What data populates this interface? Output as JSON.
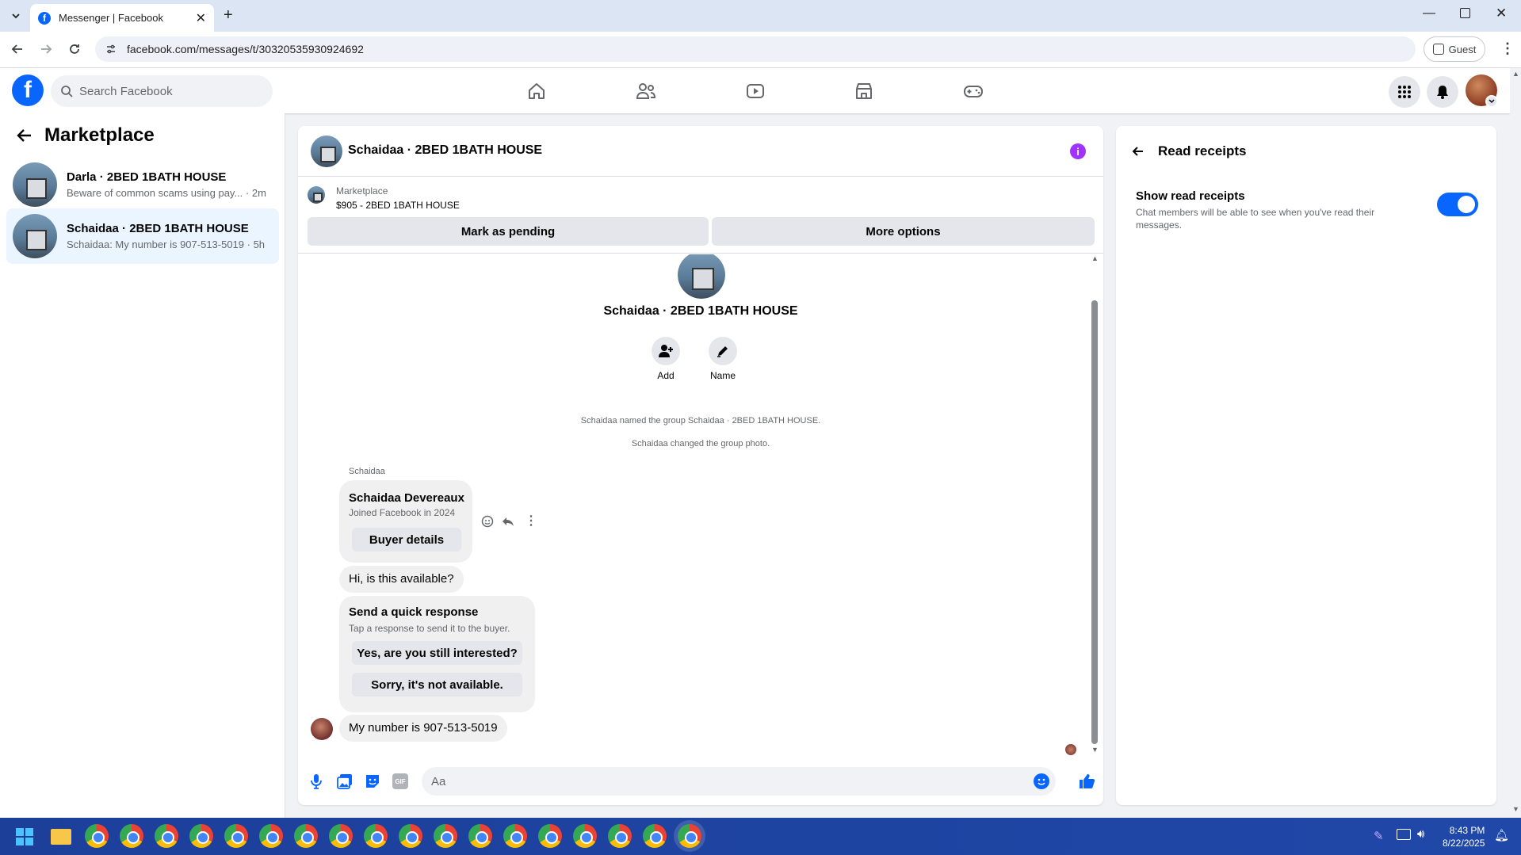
{
  "browser": {
    "tab_title": "Messenger | Facebook",
    "url": "facebook.com/messages/t/30320535930924692",
    "guest_label": "Guest"
  },
  "fb": {
    "search_placeholder": "Search Facebook"
  },
  "left_panel": {
    "title": "Marketplace",
    "conversations": [
      {
        "name": "Darla · 2BED 1BATH HOUSE",
        "preview": "Beware of common scams using pay... · 2m",
        "active": false
      },
      {
        "name": "Schaidaa · 2BED 1BATH HOUSE",
        "preview": "Schaidaa: My number is 907-513-5019 · 5h",
        "active": true
      }
    ]
  },
  "chat": {
    "title": "Schaidaa · 2BED 1BATH HOUSE",
    "listing_source": "Marketplace",
    "listing_title": "$905 - 2BED 1BATH HOUSE",
    "mark_pending_label": "Mark as pending",
    "more_options_label": "More options",
    "group_name": "Schaidaa · 2BED 1BATH HOUSE",
    "add_label": "Add",
    "name_label": "Name",
    "system_messages": [
      "Schaidaa named the group Schaidaa · 2BED 1BATH HOUSE.",
      "Schaidaa changed the group photo."
    ],
    "sender_name": "Schaidaa",
    "card": {
      "name": "Schaidaa Devereaux",
      "joined": "Joined Facebook in 2024",
      "buyer_details_label": "Buyer details"
    },
    "msg_available": "Hi, is this available?",
    "quick": {
      "title": "Send a quick response",
      "subtitle": "Tap a response to send it to the buyer.",
      "option1": "Yes, are you still interested?",
      "option2": "Sorry, it's not available."
    },
    "msg_number": "My number is 907-513-5019",
    "composer_placeholder": "Aa"
  },
  "right_panel": {
    "title": "Read receipts",
    "setting_label": "Show read receipts",
    "setting_desc": "Chat members will be able to see when you've read their messages.",
    "toggle_on": true
  },
  "taskbar": {
    "time": "8:43 PM",
    "date": "8/22/2025"
  },
  "colors": {
    "brand": "#0866ff",
    "accent_purple": "#a033ff"
  }
}
